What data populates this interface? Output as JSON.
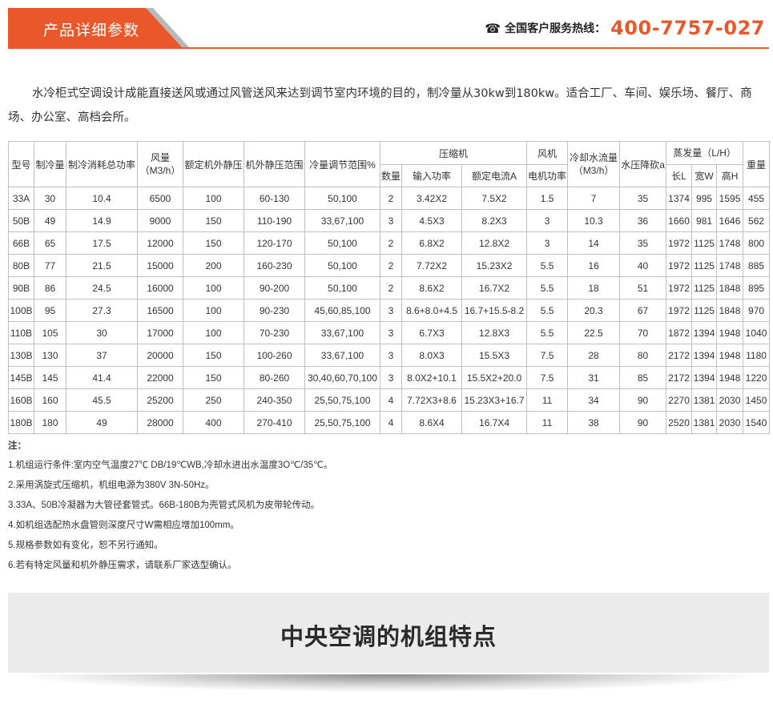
{
  "header": {
    "tab_label": "产品详细参数",
    "hotline_label": "全国客户服务热线：",
    "hotline_number": "400-7757-027",
    "phone_icon": "phone-icon",
    "accent_color": "#e9582a"
  },
  "intro": "水冷柜式空调设计成能直接送风或通过风管送风来达到调节室内环境的目的，制冷量从30kw到180kw。适合工厂、车间、娱乐场、餐厅、商场、办公室、高档会所。",
  "table": {
    "headers": {
      "model": "型号",
      "cooling": "制冷量",
      "power": "制冷消耗总功率",
      "airflow": "风量（M3/h）",
      "rated_static": "额定机外静压",
      "static_range": "机外静压范围",
      "adjust_range": "冷量调节范围%",
      "compressor": "压缩机",
      "comp_count": "数量",
      "comp_input": "输入功率",
      "comp_current": "额定电流A",
      "fan": "风机",
      "fan_motor": "电机功率",
      "water_flow": "冷却水流量（M3/h）",
      "pressure_drop": "水压降砍a",
      "evaporator": "蒸发量（L/H）",
      "len": "长L",
      "width": "宽W",
      "height": "高H",
      "weight": "重量"
    },
    "rows": [
      [
        "33A",
        "30",
        "10.4",
        "6500",
        "100",
        "60-130",
        "50,100",
        "2",
        "3.42X2",
        "7.5X2",
        "1.5",
        "7",
        "35",
        "1374",
        "995",
        "1595",
        "455"
      ],
      [
        "50B",
        "49",
        "14.9",
        "9000",
        "150",
        "110-190",
        "33,67,100",
        "3",
        "4.5X3",
        "8.2X3",
        "3",
        "10.3",
        "36",
        "1660",
        "981",
        "1646",
        "562"
      ],
      [
        "66B",
        "65",
        "17.5",
        "12000",
        "150",
        "120-170",
        "50,100",
        "2",
        "6.8X2",
        "12.8X2",
        "3",
        "14",
        "35",
        "1972",
        "1125",
        "1748",
        "800"
      ],
      [
        "80B",
        "77",
        "21.5",
        "15000",
        "200",
        "160-230",
        "50,100",
        "2",
        "7.72X2",
        "15.23X2",
        "5.5",
        "16",
        "40",
        "1972",
        "1125",
        "1748",
        "885"
      ],
      [
        "90B",
        "86",
        "24.5",
        "16000",
        "100",
        "90-200",
        "50,100",
        "2",
        "8.6X2",
        "16.7X2",
        "5.5",
        "18",
        "51",
        "1972",
        "1125",
        "1848",
        "895"
      ],
      [
        "100B",
        "95",
        "27.3",
        "16500",
        "100",
        "90-230",
        "45,60,85,100",
        "3",
        "8.6+8.0+4.5",
        "16.7+15.5-8.2",
        "5.5",
        "20.3",
        "67",
        "1972",
        "1125",
        "1848",
        "970"
      ],
      [
        "110B",
        "105",
        "30",
        "17000",
        "100",
        "70-230",
        "33,67,100",
        "3",
        "6.7X3",
        "12.8X3",
        "5.5",
        "22.5",
        "70",
        "1872",
        "1394",
        "1948",
        "1040"
      ],
      [
        "130B",
        "130",
        "37",
        "20000",
        "150",
        "100-260",
        "33,67,100",
        "3",
        "8.0X3",
        "15.5X3",
        "7.5",
        "28",
        "80",
        "2172",
        "1394",
        "1948",
        "1180"
      ],
      [
        "145B",
        "145",
        "41.4",
        "22000",
        "150",
        "80-260",
        "30,40,60,70,100",
        "3",
        "8.0X2+10.1",
        "15.5X2+20.0",
        "7.5",
        "31",
        "85",
        "2172",
        "1394",
        "1948",
        "1220"
      ],
      [
        "160B",
        "160",
        "45.5",
        "25200",
        "250",
        "240-350",
        "25,50,75,100",
        "4",
        "7.72X3+8.6",
        "15.23X3+16.7",
        "11",
        "34",
        "90",
        "2270",
        "1381",
        "2030",
        "1450"
      ],
      [
        "180B",
        "180",
        "49",
        "28000",
        "400",
        "270-410",
        "25,50,75,100",
        "4",
        "8.6X4",
        "16.7X4",
        "11",
        "38",
        "90",
        "2520",
        "1381",
        "2030",
        "1540"
      ]
    ]
  },
  "notes": {
    "title": "注：",
    "items": [
      "1.机组运行条件:室内空气温度27℃ DB/19℃WB,冷却水进出水温度3O℃/35℃。",
      "2.采用涡旋式压缩机，机组电源为380V 3N-50Hz。",
      "3.33A、50B冷凝器为大管径套管式。66B-180B为壳管式风机为皮带轮传动。",
      "4.如机组选配热水盘管则深度尺寸W需相应增加100mm。",
      "5.规格参数如有变化，恕不另行通知。",
      "6.若有特定风量和机外静压需求，请联系厂家选型确认。"
    ]
  },
  "feature_banner": {
    "title": "中央空调的机组特点"
  }
}
